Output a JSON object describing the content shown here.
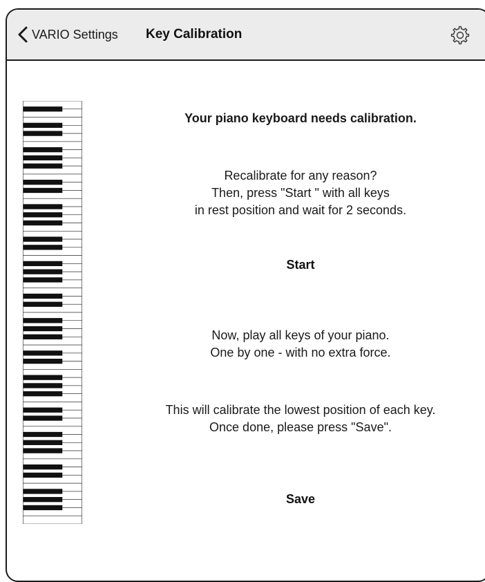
{
  "header": {
    "back_label": "VARIO Settings",
    "title": "Key Calibration",
    "back_icon": "chevron-left-icon",
    "settings_icon": "gear-icon"
  },
  "main": {
    "needs_calibration": "Your piano keyboard needs calibration.",
    "recalibrate_lines": [
      "Recalibrate for any reason?",
      "Then, press \"Start \" with all keys",
      "in rest position and wait for 2 seconds."
    ],
    "start_label": "Start",
    "play_lines": [
      "Now, play all keys of your piano.",
      "One by one - with no extra force."
    ],
    "calibrate_lines": [
      "This will calibrate the lowest position of each key.",
      "Once done, please press \"Save\"."
    ],
    "save_label": "Save"
  },
  "keyboard": {
    "white_keys": 52
  },
  "colors": {
    "header_bg": "#ececec",
    "border": "#1a1a1a",
    "text": "#111111"
  }
}
